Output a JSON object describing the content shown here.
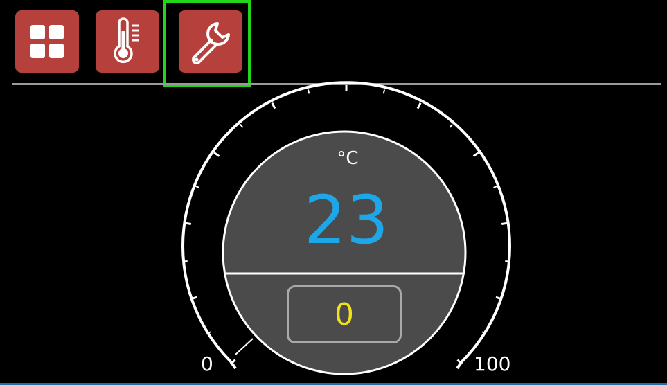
{
  "toolbar": {
    "buttons": [
      {
        "id": "home",
        "icon": "grid-icon"
      },
      {
        "id": "temperature",
        "icon": "thermometer-icon"
      },
      {
        "id": "settings",
        "icon": "wrench-icon",
        "selected": true
      }
    ],
    "button_color": "#b5403c",
    "selection_color": "#22d61c"
  },
  "gauge": {
    "unit": "°C",
    "value": "23",
    "setpoint": "0",
    "scale_min": "0",
    "scale_max": "100",
    "value_color": "#1ea7e8",
    "setpoint_color": "#f2e21c",
    "face_color": "#4b4b4b"
  }
}
